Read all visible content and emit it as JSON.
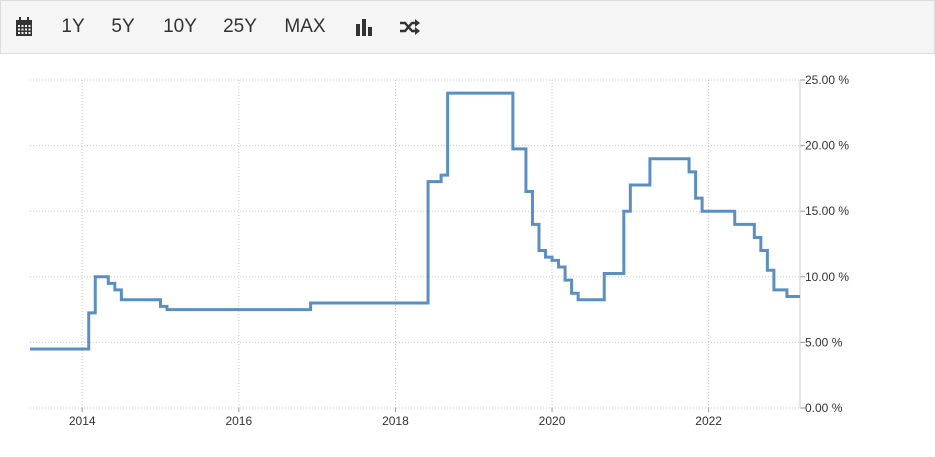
{
  "toolbar": {
    "calendar_icon": "calendar-icon",
    "ranges": [
      "1Y",
      "5Y",
      "10Y",
      "25Y",
      "MAX"
    ],
    "chart_type_icon": "bar-chart-icon",
    "shuffle_icon": "shuffle-icon"
  },
  "colors": {
    "line": "#5b8fc0",
    "grid": "#c8c8c8",
    "toolbar_bg": "#f5f5f5"
  },
  "chart_data": {
    "type": "line",
    "step": true,
    "title": "",
    "xlabel": "",
    "ylabel": "",
    "grid": true,
    "y_axis_position": "right",
    "xlim": [
      "2013-05",
      "2023-03"
    ],
    "ylim": [
      0,
      25
    ],
    "x_ticks": [
      "2014",
      "2016",
      "2018",
      "2020",
      "2022"
    ],
    "y_ticks": [
      "0.00 %",
      "5.00 %",
      "10.00 %",
      "15.00 %",
      "20.00 %",
      "25.00 %"
    ],
    "series": [
      {
        "x": [
          "2013-05",
          "2014-02",
          "2014-03",
          "2014-05",
          "2014-06",
          "2014-07",
          "2015-01",
          "2015-02",
          "2016-12",
          "2018-06",
          "2018-07",
          "2018-08",
          "2018-09",
          "2019-07",
          "2019-08",
          "2019-09",
          "2019-10",
          "2019-11",
          "2019-12",
          "2020-01",
          "2020-02",
          "2020-03",
          "2020-04",
          "2020-05",
          "2020-09",
          "2020-12",
          "2021-01",
          "2021-03",
          "2021-04",
          "2021-09",
          "2021-10",
          "2021-11",
          "2021-12",
          "2022-05",
          "2022-06",
          "2022-07",
          "2022-08",
          "2022-09",
          "2022-10",
          "2022-11",
          "2022-12",
          "2023-01",
          "2023-03"
        ],
        "y": [
          4.5,
          7.25,
          10,
          9.5,
          9,
          8.25,
          7.75,
          7.5,
          8,
          17.25,
          17.25,
          17.75,
          24,
          19.75,
          19.75,
          16.5,
          14,
          12,
          11.5,
          11.25,
          10.75,
          9.75,
          8.75,
          8.25,
          10.25,
          15,
          17,
          17,
          19,
          19,
          18,
          16,
          15,
          14,
          14,
          14,
          13,
          12,
          10.5,
          9,
          9,
          8.5,
          8.5
        ]
      }
    ]
  }
}
